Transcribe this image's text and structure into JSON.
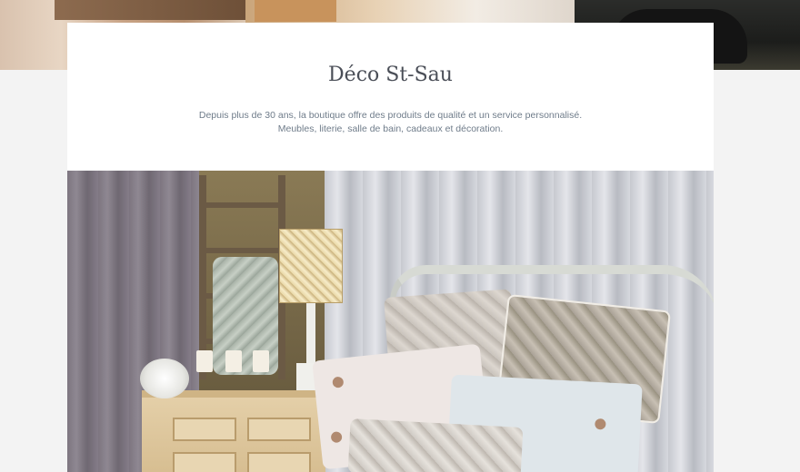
{
  "brand": {
    "title": "Déco St-Sau"
  },
  "intro": {
    "line1": "Depuis plus de 30 ans, la boutique offre des produits de qualité et un service personnalisé.",
    "line2": "Meubles, literie, salle de bain, cadeaux et décoration."
  },
  "colors": {
    "page_background": "#f3f3f3",
    "card_background": "#ffffff",
    "title_color": "#4a4e57",
    "text_color": "#6f7c8a"
  }
}
